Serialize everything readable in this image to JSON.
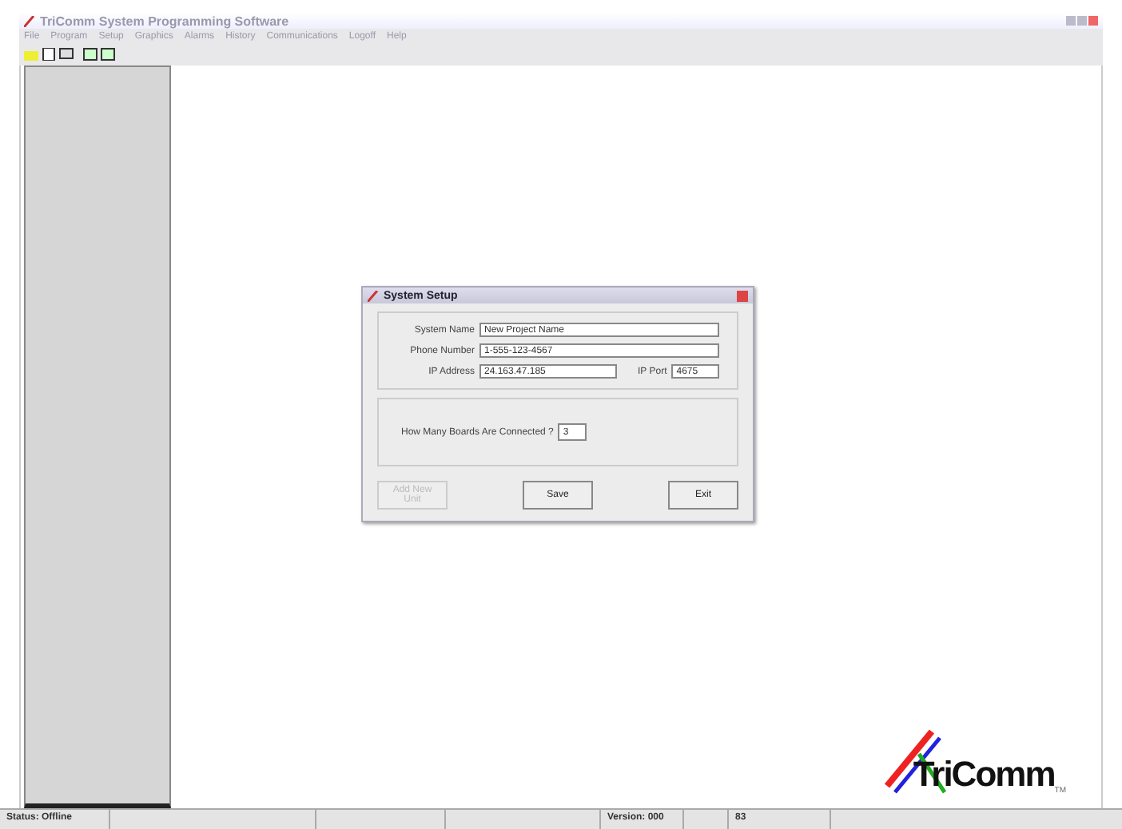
{
  "window": {
    "title": "TriComm System Programming Software"
  },
  "menu": [
    "File",
    "Program",
    "Setup",
    "Graphics",
    "Alarms",
    "History",
    "Communications",
    "Logoff",
    "Help"
  ],
  "dialog": {
    "title": "System Setup",
    "fields": [
      {
        "label": "System Name",
        "value": "New Project Name"
      },
      {
        "label": "Phone Number",
        "value": "1-555-123-4567"
      },
      {
        "label": "IP Address",
        "value": "24.163.47.185"
      },
      {
        "label": "IP Port",
        "value": "4675"
      }
    ],
    "boards": {
      "label": "How Many Boards Are Connected ?",
      "value": "3"
    },
    "buttons": [
      {
        "label": "Add New Unit",
        "disabled": true
      },
      {
        "label": "Save",
        "disabled": false
      },
      {
        "label": "Exit",
        "disabled": false
      }
    ]
  },
  "logo": {
    "text": "TriComm",
    "mark": "TM"
  },
  "status_bar": {
    "status": "Status: Offline",
    "version": "Version: 000",
    "code": "83"
  }
}
